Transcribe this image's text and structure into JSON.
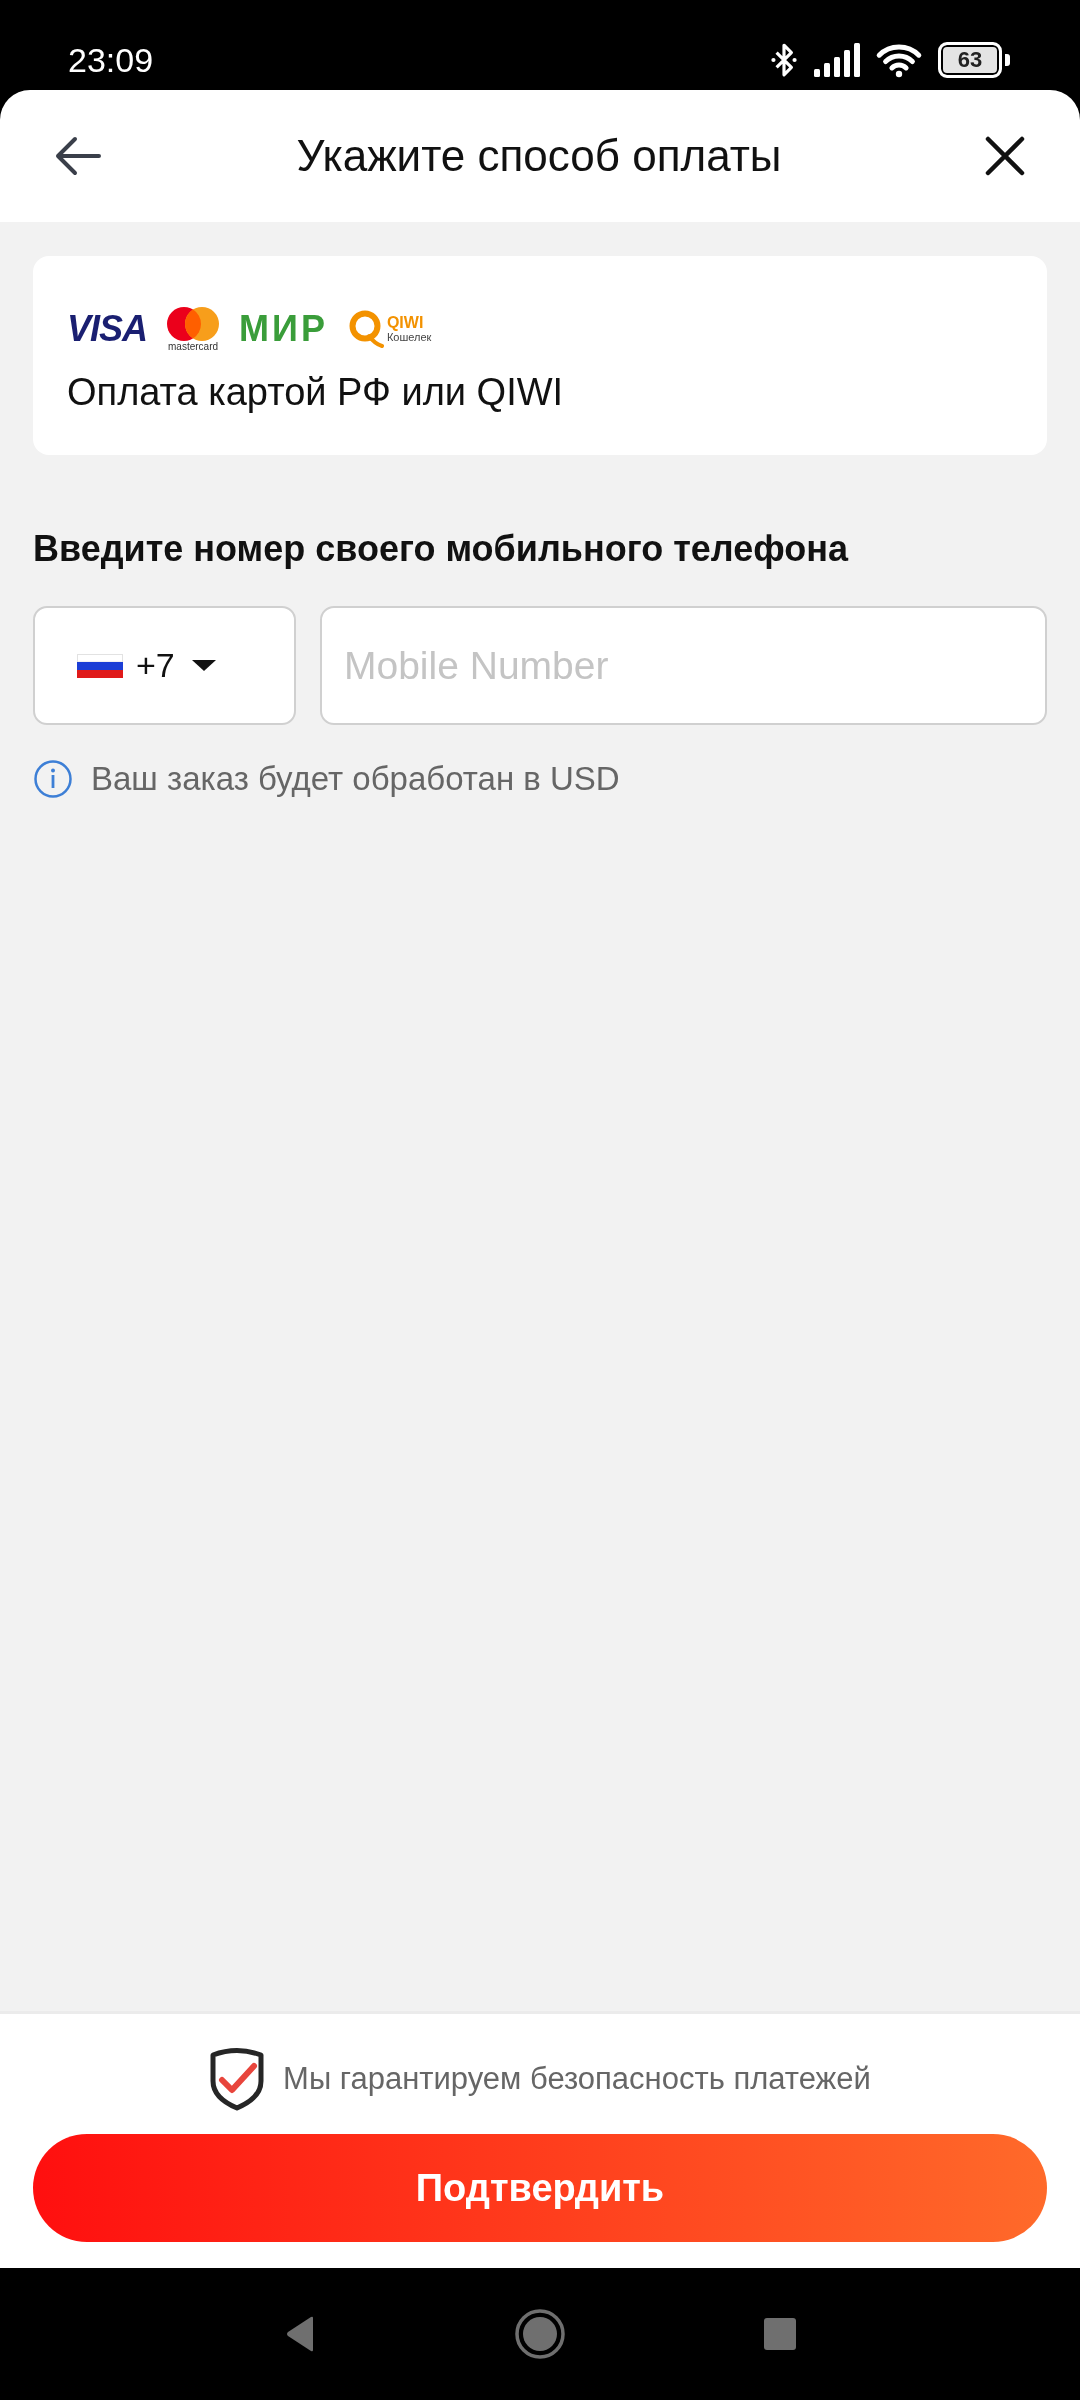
{
  "status_bar": {
    "time": "23:09",
    "battery": "63"
  },
  "header": {
    "title": "Укажите способ оплаты"
  },
  "payment_method": {
    "logos": [
      {
        "kind": "visa",
        "text": "VISA"
      },
      {
        "kind": "mastercard",
        "caption": "mastercard"
      },
      {
        "kind": "mir",
        "text": "МИР"
      },
      {
        "kind": "qiwi",
        "text": "QIWI",
        "caption": "Кошелек"
      }
    ],
    "label": "Оплата картой РФ или QIWI"
  },
  "phone_section": {
    "heading": "Введите номер своего мобильного телефона",
    "country_code": "+7",
    "placeholder": "Mobile Number",
    "note": "Ваш заказ будет обработан в USD"
  },
  "footer": {
    "security_note": "Мы гарантируем безопасность платежей",
    "confirm_button": "Подтвердить"
  }
}
